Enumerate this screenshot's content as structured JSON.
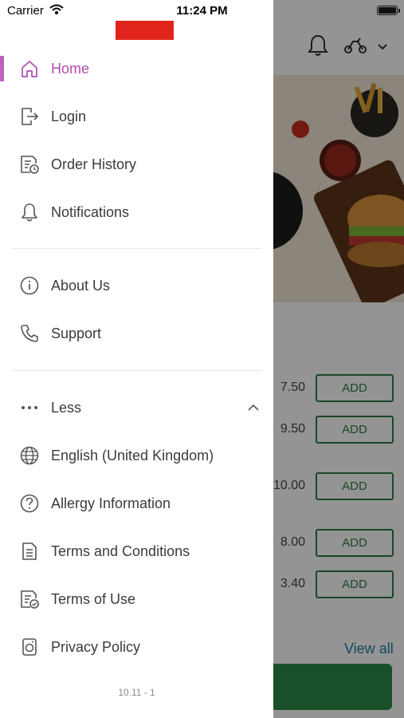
{
  "status_bar": {
    "carrier": "Carrier",
    "time": "11:24 PM"
  },
  "drawer": {
    "menu_primary": [
      {
        "label": "Home",
        "icon": "home-icon",
        "active": true
      },
      {
        "label": "Login",
        "icon": "login-icon"
      },
      {
        "label": "Order History",
        "icon": "order-history-icon"
      },
      {
        "label": "Notifications",
        "icon": "bell-icon"
      }
    ],
    "menu_secondary": [
      {
        "label": "About Us",
        "icon": "info-icon"
      },
      {
        "label": "Support",
        "icon": "phone-icon"
      }
    ],
    "menu_more": [
      {
        "label": "Less",
        "icon": "more-dots-icon"
      },
      {
        "label": "English (United Kingdom)",
        "icon": "globe-icon"
      },
      {
        "label": "Allergy Information",
        "icon": "help-circle-icon"
      },
      {
        "label": "Terms and Conditions",
        "icon": "document-icon"
      },
      {
        "label": "Terms of Use",
        "icon": "document-check-icon"
      },
      {
        "label": "Privacy Policy",
        "icon": "privacy-icon"
      }
    ],
    "version": "10.11 - 1",
    "colors": {
      "active": "#b24bb0",
      "logo": "#e0241b"
    }
  },
  "background": {
    "items": [
      {
        "price": "7.50",
        "button": "ADD"
      },
      {
        "price": "9.50",
        "button": "ADD"
      },
      {
        "price": "10.00",
        "button": "ADD"
      },
      {
        "price": "8.00",
        "button": "ADD"
      },
      {
        "price": "3.40",
        "button": "ADD"
      }
    ],
    "view_all": "View all",
    "colors": {
      "add": "#2e7d43",
      "view_all": "#1f7fa6",
      "cta": "#2e8b47"
    }
  }
}
